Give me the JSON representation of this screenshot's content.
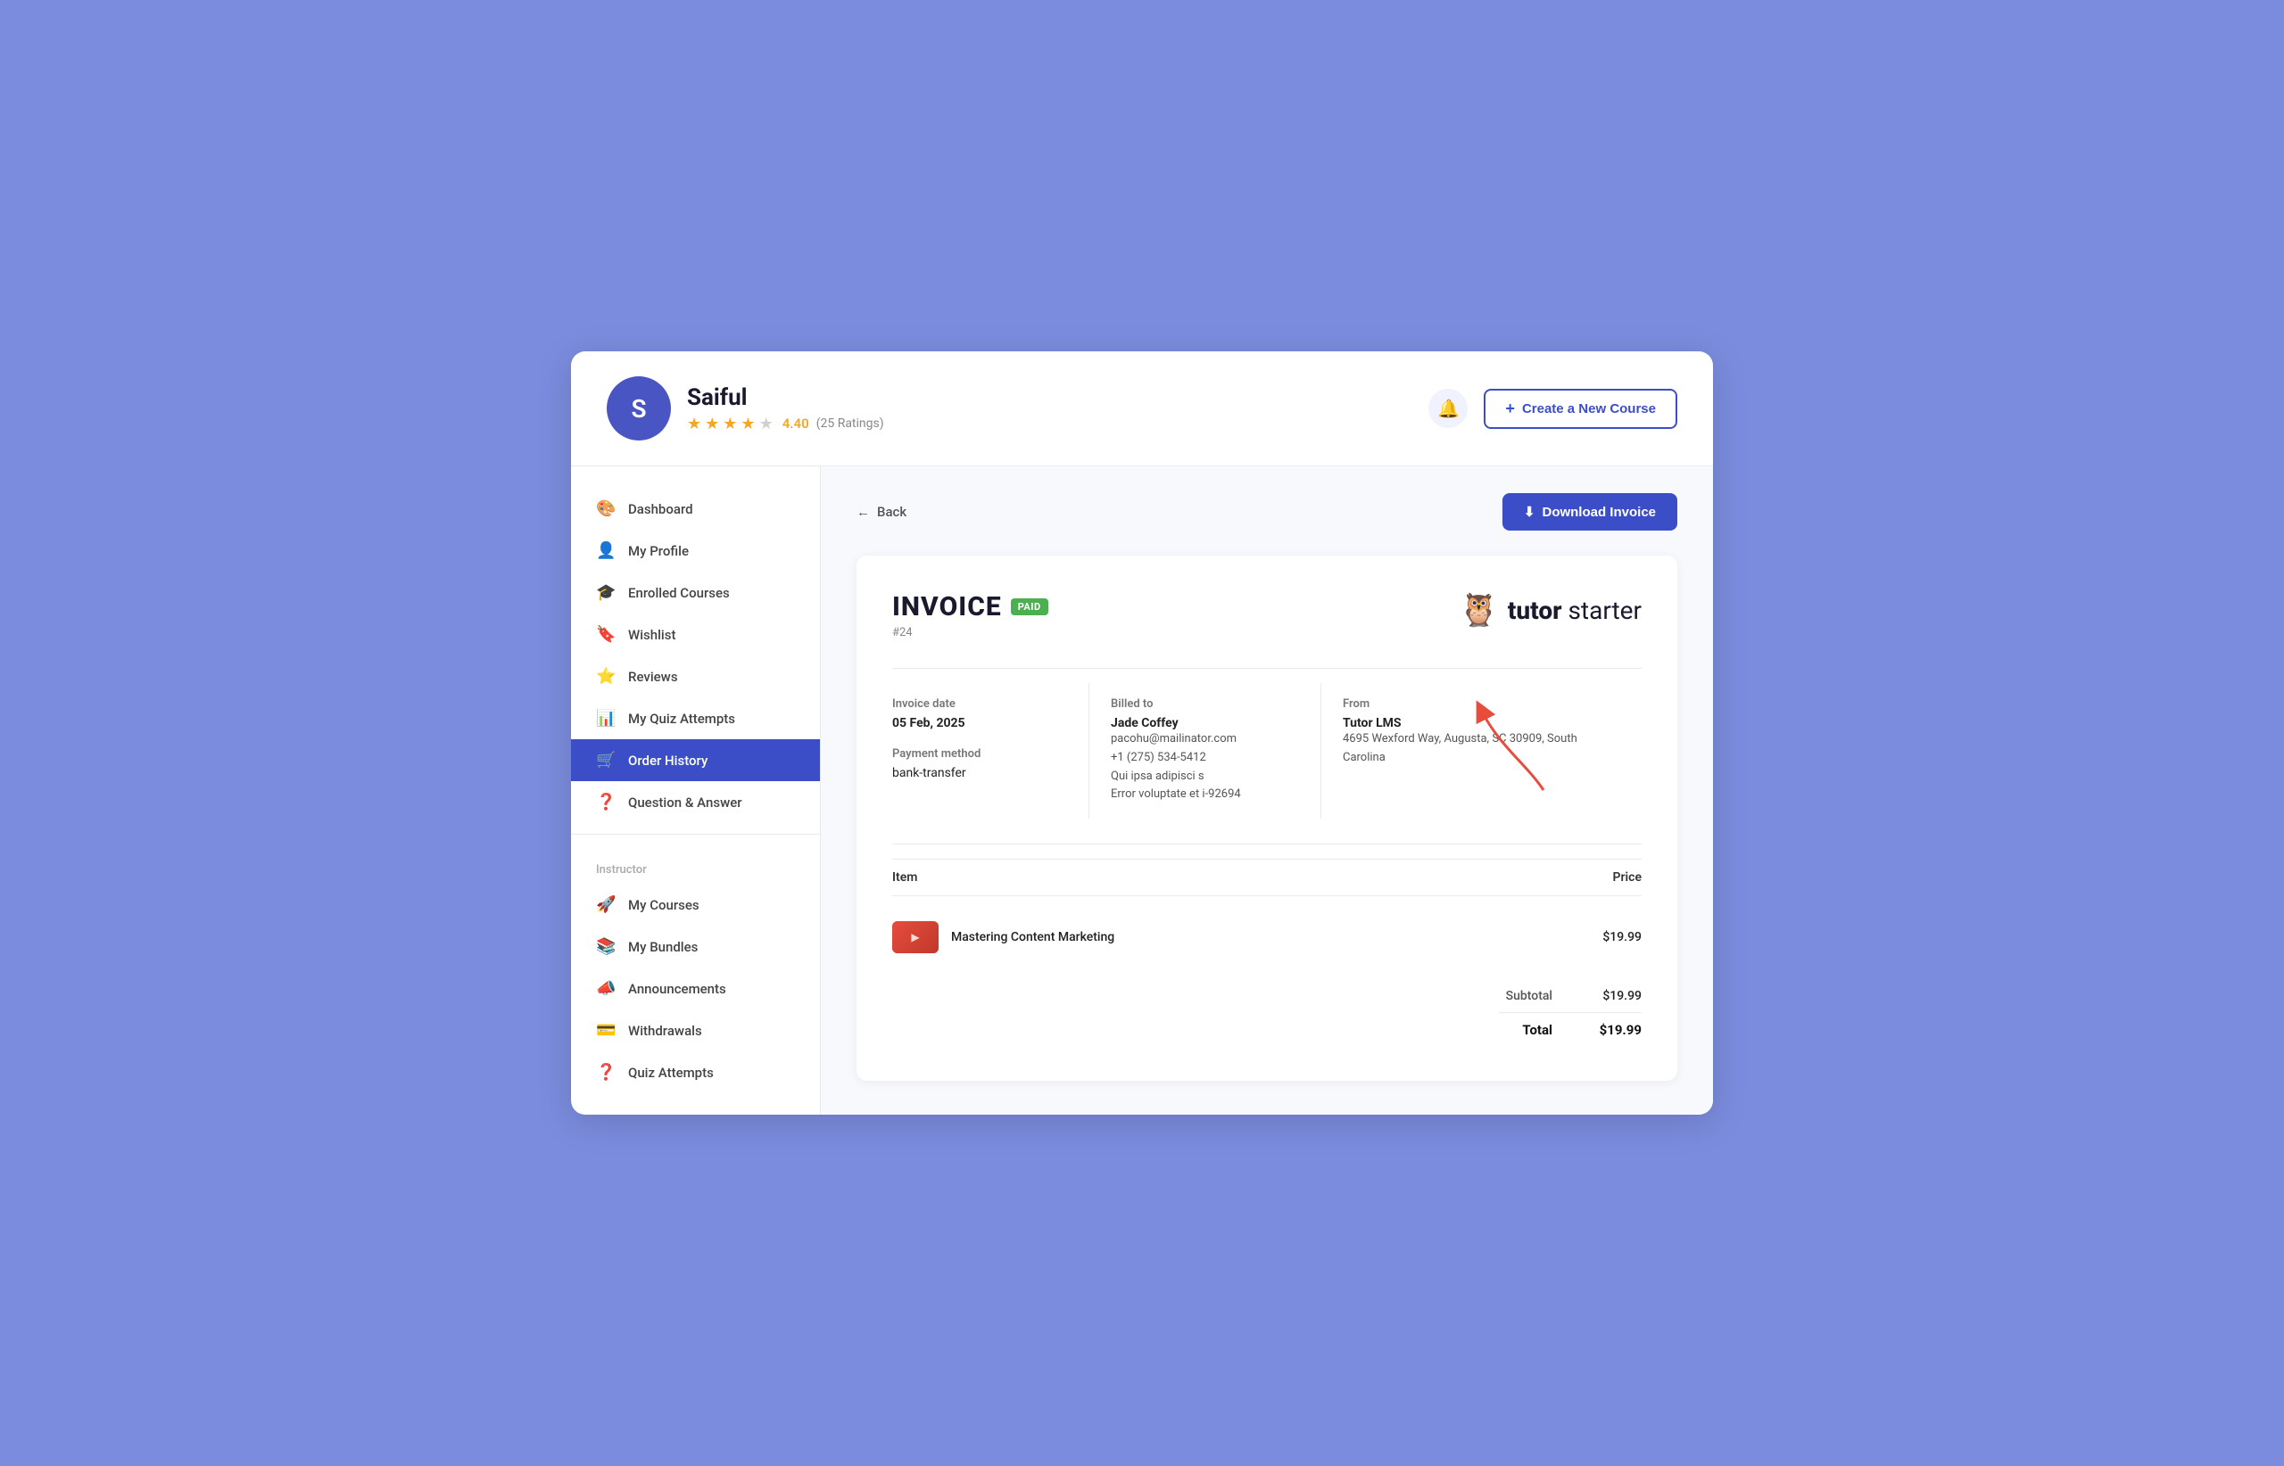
{
  "header": {
    "avatar_letter": "S",
    "user_name": "Saiful",
    "rating": "4.40",
    "rating_count": "(25 Ratings)",
    "bell_label": "notifications",
    "create_btn_label": "Create a New Course"
  },
  "sidebar": {
    "nav_items": [
      {
        "id": "dashboard",
        "label": "Dashboard",
        "icon": "🎨",
        "active": false
      },
      {
        "id": "my-profile",
        "label": "My Profile",
        "icon": "👤",
        "active": false
      },
      {
        "id": "enrolled-courses",
        "label": "Enrolled Courses",
        "icon": "🎓",
        "active": false
      },
      {
        "id": "wishlist",
        "label": "Wishlist",
        "icon": "🔖",
        "active": false
      },
      {
        "id": "reviews",
        "label": "Reviews",
        "icon": "⭐",
        "active": false
      },
      {
        "id": "my-quiz-attempts",
        "label": "My Quiz Attempts",
        "icon": "📊",
        "active": false
      },
      {
        "id": "order-history",
        "label": "Order History",
        "icon": "🛒",
        "active": true
      },
      {
        "id": "question-answer",
        "label": "Question & Answer",
        "icon": "❓",
        "active": false
      }
    ],
    "instructor_label": "Instructor",
    "instructor_items": [
      {
        "id": "my-courses",
        "label": "My Courses",
        "icon": "🚀",
        "active": false
      },
      {
        "id": "my-bundles",
        "label": "My Bundles",
        "icon": "📚",
        "active": false
      },
      {
        "id": "announcements",
        "label": "Announcements",
        "icon": "📣",
        "active": false
      },
      {
        "id": "withdrawals",
        "label": "Withdrawals",
        "icon": "💳",
        "active": false
      },
      {
        "id": "quiz-attempts",
        "label": "Quiz Attempts",
        "icon": "❓",
        "active": false
      }
    ]
  },
  "content": {
    "back_label": "Back",
    "download_label": "Download Invoice",
    "invoice": {
      "title": "INVOICE",
      "status_badge": "PAID",
      "number": "#24",
      "brand_name": "tutor starter",
      "invoice_date_label": "Invoice date",
      "invoice_date_value": "05 Feb, 2025",
      "payment_method_label": "Payment method",
      "payment_method_value": "bank-transfer",
      "billed_to_label": "Billed to",
      "billed_name": "Jade Coffey",
      "billed_email": "pacohu@mailinator.com",
      "billed_phone": "+1 (275) 534-5412",
      "billed_address_line1": "Qui ipsa adipisci s",
      "billed_address_line2": "Error voluptate et i-92694",
      "from_label": "From",
      "from_company": "Tutor LMS",
      "from_address": "4695 Wexford Way, Augusta, SC 30909, South Carolina",
      "items_label": "Item",
      "price_label": "Price",
      "items": [
        {
          "name": "Mastering Content Marketing",
          "price": "$19.99"
        }
      ],
      "subtotal_label": "Subtotal",
      "subtotal_value": "$19.99",
      "total_label": "Total",
      "total_value": "$19.99"
    }
  }
}
